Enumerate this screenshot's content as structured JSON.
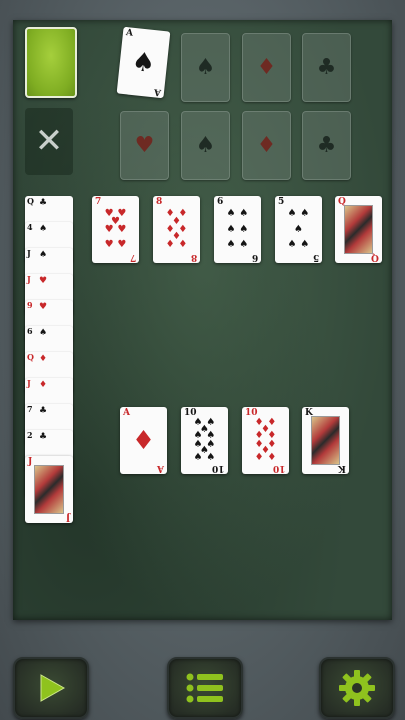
{
  "foundations_top": [
    {
      "rank": "A",
      "suit": "♠",
      "color": "black",
      "filled": true
    },
    {
      "suit": "♠",
      "color": "black",
      "filled": false
    },
    {
      "suit": "♦",
      "color": "red",
      "filled": false
    },
    {
      "suit": "♣",
      "color": "black",
      "filled": false
    }
  ],
  "foundations_bottom": [
    {
      "suit": "♥",
      "color": "red"
    },
    {
      "suit": "♠",
      "color": "black"
    },
    {
      "suit": "♦",
      "color": "red"
    },
    {
      "suit": "♣",
      "color": "black"
    }
  ],
  "waste_icon": "✕",
  "reserve_column": [
    {
      "rank": "Q",
      "suit": "♣",
      "color": "black"
    },
    {
      "rank": "4",
      "suit": "♠",
      "color": "black"
    },
    {
      "rank": "J",
      "suit": "♠",
      "color": "black"
    },
    {
      "rank": "J",
      "suit": "♥",
      "color": "red"
    },
    {
      "rank": "9",
      "suit": "♥",
      "color": "red"
    },
    {
      "rank": "6",
      "suit": "♠",
      "color": "black"
    },
    {
      "rank": "Q",
      "suit": "♦",
      "color": "red"
    },
    {
      "rank": "J",
      "suit": "♦",
      "color": "red"
    },
    {
      "rank": "7",
      "suit": "♣",
      "color": "black"
    },
    {
      "rank": "2",
      "suit": "♣",
      "color": "black"
    },
    {
      "rank": "J",
      "suit": "♥",
      "color": "red"
    }
  ],
  "tableau_row1": [
    {
      "rank": "7",
      "suit": "♥",
      "color": "red"
    },
    {
      "rank": "8",
      "suit": "♦",
      "color": "red"
    },
    {
      "rank": "6",
      "suit": "♠",
      "color": "black"
    },
    {
      "rank": "5",
      "suit": "♠",
      "color": "black"
    },
    {
      "rank": "Q",
      "suit": "♦",
      "color": "red"
    }
  ],
  "tableau_row2": [
    {
      "rank": "A",
      "suit": "♦",
      "color": "red"
    },
    {
      "rank": "10",
      "suit": "♠",
      "color": "black"
    },
    {
      "rank": "10",
      "suit": "♦",
      "color": "red"
    },
    {
      "rank": "K",
      "suit": "♣",
      "color": "black"
    }
  ],
  "toolbar": {
    "play_icon": "play-icon",
    "menu_icon": "menu-list-icon",
    "settings_icon": "gear-icon",
    "accent": "#8fc21e"
  }
}
